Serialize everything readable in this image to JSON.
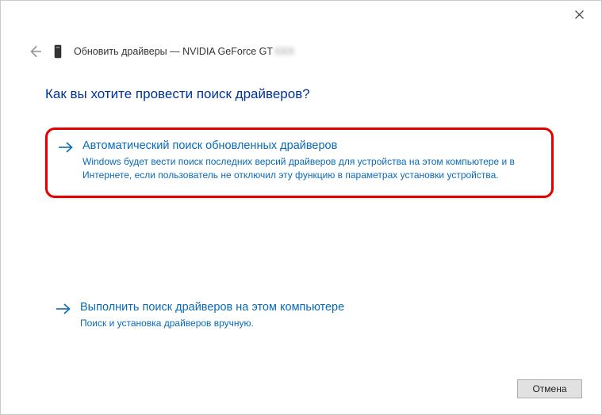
{
  "window": {
    "title_prefix": "Обновить драйверы — ",
    "device_name": "NVIDIA GeForce GT",
    "device_suffix_blurred": "XXX"
  },
  "heading": "Как вы хотите провести поиск драйверов?",
  "options": {
    "auto": {
      "title": "Автоматический поиск обновленных драйверов",
      "desc": "Windows будет вести поиск последних версий драйверов для устройства на этом компьютере и в Интернете, если пользователь не отключил эту функцию в параметрах установки устройства."
    },
    "manual": {
      "title": "Выполнить поиск драйверов на этом компьютере",
      "desc": "Поиск и установка драйверов вручную."
    }
  },
  "buttons": {
    "cancel": "Отмена"
  }
}
